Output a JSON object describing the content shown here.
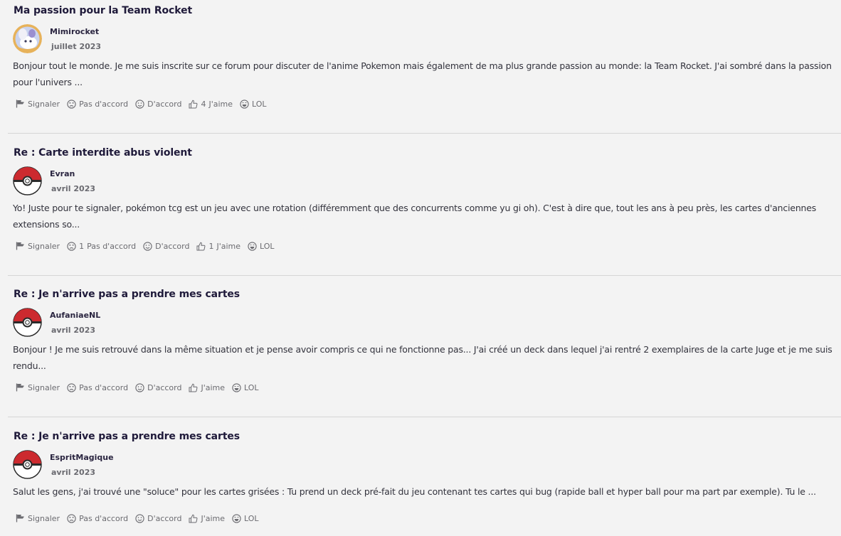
{
  "posts": [
    {
      "title": "Ma passion pour la Team Rocket",
      "author": "Mimirocket",
      "date": "juillet 2023",
      "avatar": "character-avatar",
      "excerpt": "Bonjour tout le monde. Je me suis inscrite sur ce forum pour discuter de l'anime Pokemon mais également de ma plus grande passion au monde: la Team Rocket. J'ai sombré dans la passion pour l'univers ...",
      "actions": {
        "report": "Signaler",
        "disagree": "Pas d'accord",
        "disagree_count": "",
        "agree": "D'accord",
        "like": "J'aime",
        "like_count": "4",
        "lol": "LOL"
      }
    },
    {
      "title": "Re : Carte interdite abus violent",
      "author": "Evran",
      "date": "avril 2023",
      "avatar": "pokeball-avatar",
      "excerpt": "Yo! Juste pour te signaler, pokémon tcg est un jeu avec une rotation (différemment que des concurrents comme yu gi oh). C'est à dire que, tout les ans à peu près, les cartes d'anciennes extensions so...",
      "actions": {
        "report": "Signaler",
        "disagree": "Pas d'accord",
        "disagree_count": "1",
        "agree": "D'accord",
        "like": "J'aime",
        "like_count": "1",
        "lol": "LOL"
      }
    },
    {
      "title": "Re : Je n'arrive pas a prendre mes cartes",
      "author": "AufaniaeNL",
      "date": "avril 2023",
      "avatar": "pokeball-avatar",
      "excerpt": "Bonjour ! Je me suis retrouvé dans la même situation et je pense avoir compris ce qui ne fonctionne pas... J'ai créé un deck dans lequel j'ai rentré 2 exemplaires de la carte Juge et je me suis rendu...",
      "actions": {
        "report": "Signaler",
        "disagree": "Pas d'accord",
        "disagree_count": "",
        "agree": "D'accord",
        "like": "J'aime",
        "like_count": "",
        "lol": "LOL"
      }
    },
    {
      "title": "Re : Je n'arrive pas a prendre mes cartes",
      "author": "EspritMagique",
      "date": "avril 2023",
      "avatar": "pokeball-avatar",
      "excerpt": "Salut les gens, j'ai trouvé une \"soluce\" pour les cartes grisées : Tu prend un deck pré-fait du jeu contenant tes cartes qui bug (rapide ball et hyper ball pour ma part par exemple). Tu le ...",
      "actions": {
        "report": "Signaler",
        "disagree": "Pas d'accord",
        "disagree_count": "",
        "agree": "D'accord",
        "like": "J'aime",
        "like_count": "",
        "lol": "LOL"
      }
    }
  ],
  "colors": {
    "background": "#f3f3f3",
    "title": "#1f1a3a",
    "pokeball_red": "#cc2a2f"
  }
}
